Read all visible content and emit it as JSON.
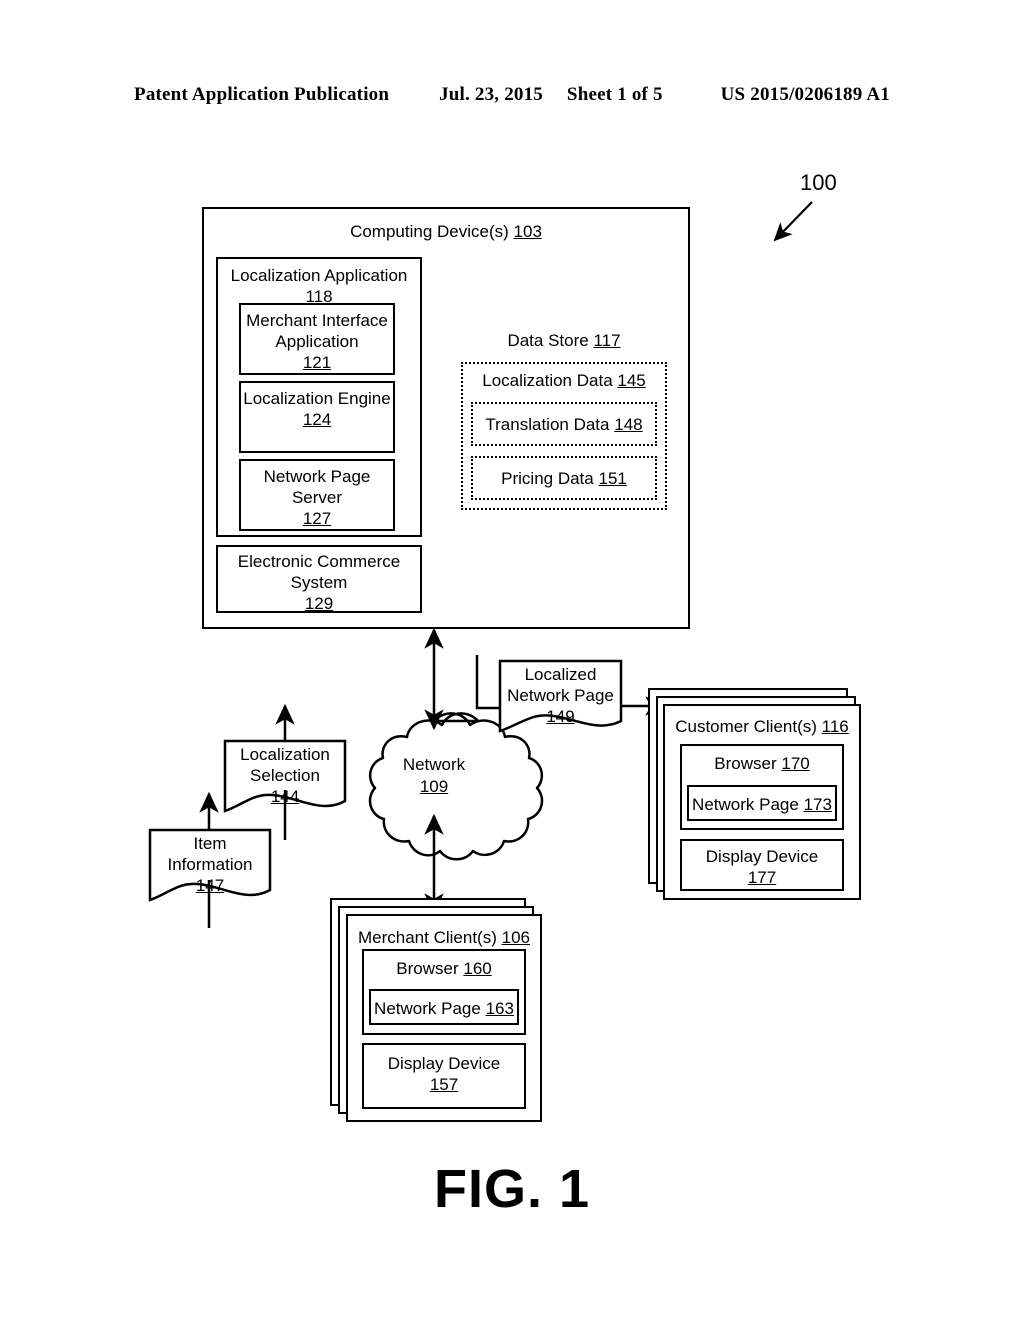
{
  "header": {
    "publication": "Patent Application Publication",
    "date": "Jul. 23, 2015",
    "sheet": "Sheet 1 of 5",
    "number": "US 2015/0206189 A1"
  },
  "figure": {
    "caption": "FIG. 1",
    "system_ref": "100"
  },
  "diagram": {
    "computing_device": {
      "label": "Computing Device(s)",
      "ref": "103"
    },
    "localization_application": {
      "label": "Localization Application",
      "ref": "118",
      "children": [
        {
          "label": "Merchant Interface Application",
          "ref": "121"
        },
        {
          "label": "Localization Engine",
          "ref": "124"
        },
        {
          "label": "Network Page Server",
          "ref": "127"
        }
      ]
    },
    "electronic_commerce_system": {
      "label": "Electronic Commerce System",
      "ref": "129"
    },
    "data_store": {
      "label": "Data Store",
      "ref": "117",
      "localization_data": {
        "label": "Localization Data",
        "ref": "145",
        "translation_data": {
          "label": "Translation Data",
          "ref": "148"
        },
        "pricing_data": {
          "label": "Pricing Data",
          "ref": "151"
        }
      }
    },
    "network": {
      "label": "Network",
      "ref": "109"
    },
    "localized_network_page": {
      "label": "Localized Network Page",
      "ref": "149"
    },
    "localization_selection": {
      "label": "Localization Selection",
      "ref": "144"
    },
    "item_information": {
      "label": "Item Information",
      "ref": "147"
    },
    "customer_client": {
      "label": "Customer Client(s)",
      "ref": "116",
      "browser": {
        "label": "Browser",
        "ref": "170"
      },
      "network_page": {
        "label": "Network Page",
        "ref": "173"
      },
      "display_device": {
        "label": "Display Device",
        "ref": "177"
      }
    },
    "merchant_client": {
      "label": "Merchant Client(s)",
      "ref": "106",
      "browser": {
        "label": "Browser",
        "ref": "160"
      },
      "network_page": {
        "label": "Network Page",
        "ref": "163"
      },
      "display_device": {
        "label": "Display Device",
        "ref": "157"
      }
    }
  }
}
